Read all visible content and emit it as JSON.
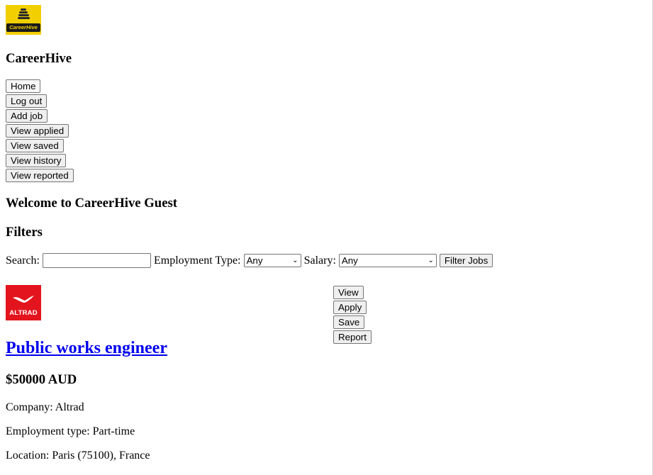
{
  "brand": {
    "name": "CareerHive",
    "logo_text": "CareerHive",
    "logo_icon": "beehive-icon",
    "logo_color": "#f2cf00"
  },
  "nav": {
    "home": "Home",
    "logout": "Log out",
    "add_job": "Add job",
    "view_applied": "View applied",
    "view_saved": "View saved",
    "view_history": "View history",
    "view_reported": "View reported"
  },
  "welcome": "Welcome to CareerHive Guest",
  "filters": {
    "heading": "Filters",
    "search_label": "Search:",
    "search_value": "",
    "employment_label": "Employment Type:",
    "employment_value": "Any",
    "salary_label": "Salary:",
    "salary_value": "Any",
    "submit_label": "Filter Jobs"
  },
  "job": {
    "logo_text": "ALTRAD",
    "logo_color": "#e3141e",
    "title": "Public works engineer",
    "salary": "$50000 AUD",
    "company": "Company: Altrad",
    "employment_type": "Employment type: Part-time",
    "location": "Location: Paris (75100), France",
    "actions": {
      "view": "View",
      "apply": "Apply",
      "save": "Save",
      "report": "Report"
    }
  }
}
